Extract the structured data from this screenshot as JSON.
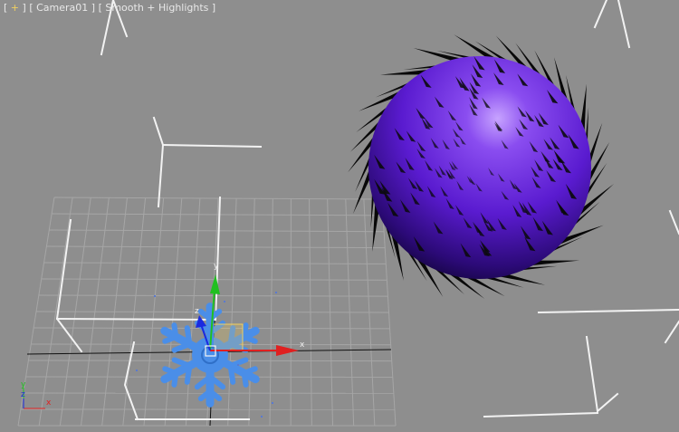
{
  "viewport": {
    "menu_open": "[",
    "menu_plus": "+",
    "menu_close": "]",
    "camera_label": "[ Camera01 ]",
    "shading_label": "[ Smooth + Highlights ]"
  },
  "gizmo": {
    "x_label": "x",
    "y_label": "y",
    "z_label": "z"
  },
  "view_axes": {
    "x_label": "x",
    "y_label": "y",
    "z_label": "z"
  },
  "colors": {
    "background": "#8e8e8e",
    "grid": "#a8a8a8",
    "sphere_light": "#b98aff",
    "sphere_mid": "#5a1bd0",
    "sphere_dark": "#120432",
    "spikes": "#080808",
    "emitter": "#4a8ee8",
    "axis_x": "#e02020",
    "axis_y": "#20c020",
    "axis_z": "#1a2ae0",
    "selection": "#f0d060"
  },
  "icons": [
    "snowflake-emitter-icon",
    "transform-gizmo-icon",
    "view-axis-tripod-icon"
  ]
}
